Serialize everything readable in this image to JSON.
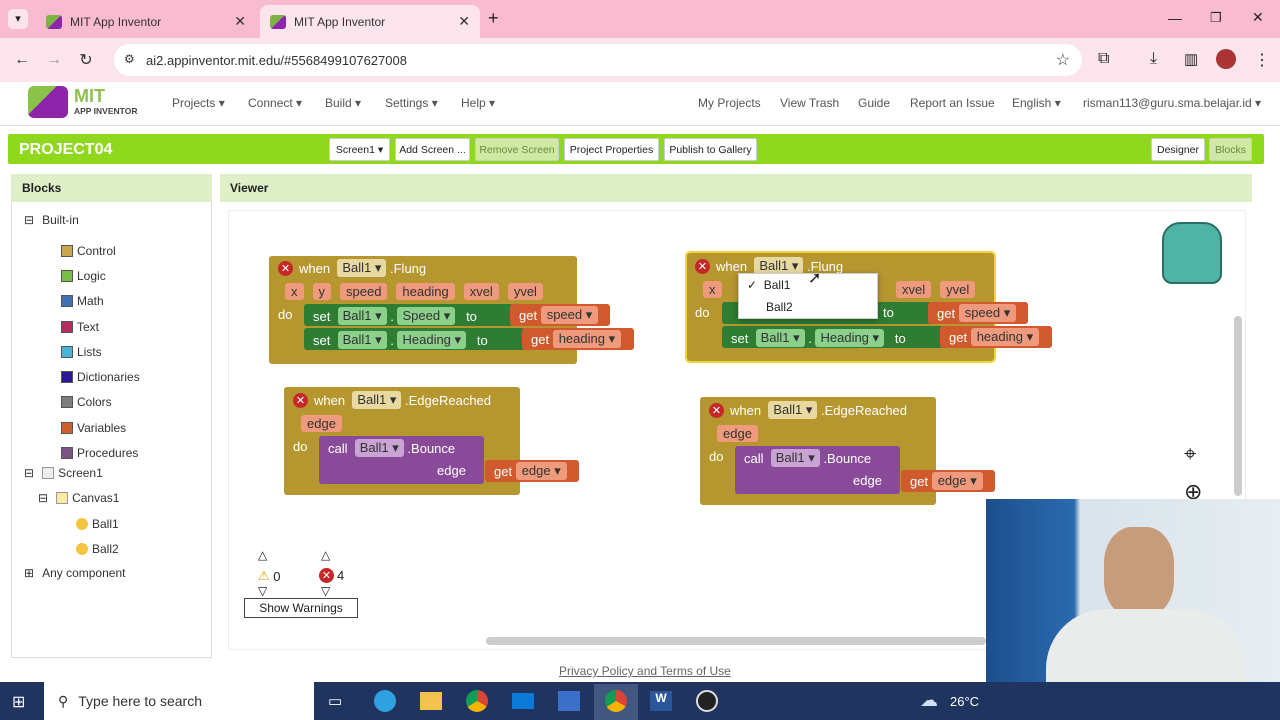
{
  "browser": {
    "tabs": [
      {
        "title": "MIT App Inventor"
      },
      {
        "title": "MIT App Inventor"
      }
    ],
    "url": "ai2.appinventor.mit.edu/#5568499107627008",
    "new_tab": "+"
  },
  "app": {
    "logo_top": "MIT",
    "logo_bottom": "APP INVENTOR",
    "menu": [
      "Projects",
      "Connect",
      "Build",
      "Settings",
      "Help"
    ],
    "right_menu": [
      "My Projects",
      "View Trash",
      "Guide",
      "Report an Issue",
      "English"
    ],
    "user": "risman113@guru.sma.belajar.id",
    "project": "PROJECT04",
    "buttons": {
      "screen": "Screen1",
      "add": "Add Screen ...",
      "remove": "Remove Screen",
      "props": "Project Properties",
      "publish": "Publish to Gallery",
      "designer": "Designer",
      "blocks": "Blocks"
    }
  },
  "panels": {
    "blocks": "Blocks",
    "viewer": "Viewer"
  },
  "tree": {
    "builtin": "Built-in",
    "items": [
      {
        "label": "Control",
        "color": "#c8a84b"
      },
      {
        "label": "Logic",
        "color": "#77c043"
      },
      {
        "label": "Math",
        "color": "#3f71b5"
      },
      {
        "label": "Text",
        "color": "#b32d5e"
      },
      {
        "label": "Lists",
        "color": "#49b3d3"
      },
      {
        "label": "Dictionaries",
        "color": "#2d1799"
      },
      {
        "label": "Colors",
        "color": "#7d7d7d"
      },
      {
        "label": "Variables",
        "color": "#d05f2d"
      },
      {
        "label": "Procedures",
        "color": "#7c5385"
      }
    ],
    "screen": "Screen1",
    "canvas": "Canvas1",
    "ball1": "Ball1",
    "ball2": "Ball2",
    "any": "Any component"
  },
  "blocks": {
    "when": "when",
    "do": "do",
    "set": "set",
    "to": "to",
    "get": "get",
    "call": "call",
    "comp": "Ball1",
    "flung": ".Flung",
    "edge_reached": ".EdgeReached",
    "bounce": ".Bounce",
    "params": [
      "x",
      "y",
      "speed",
      "heading",
      "xvel",
      "yvel"
    ],
    "edge": "edge",
    "prop_speed": "Speed",
    "prop_heading": "Heading",
    "var_speed": "speed",
    "var_heading": "heading"
  },
  "dropdown": {
    "items": [
      "Ball1",
      "Ball2"
    ],
    "checked": "✓"
  },
  "warnings": {
    "warn_count": "0",
    "error_count": "4",
    "show": "Show Warnings"
  },
  "footer": "Privacy Policy and Terms of Use",
  "taskbar": {
    "search": "Type here to search",
    "temp": "26°C"
  }
}
